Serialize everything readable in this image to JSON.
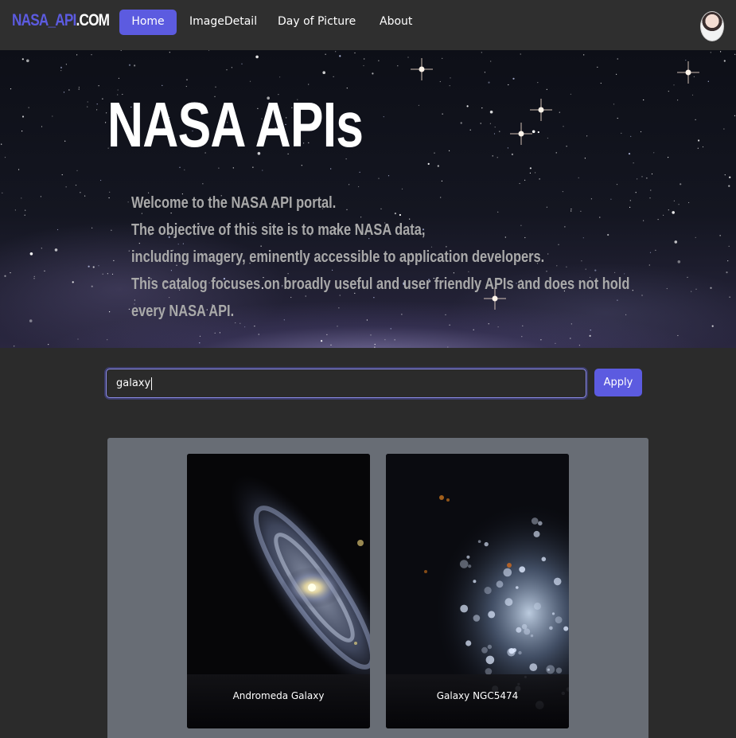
{
  "navbar": {
    "brand_part1": "NASA_API",
    "brand_part2": ".COM",
    "items": [
      {
        "label": "Home",
        "active": true
      },
      {
        "label": "ImageDetail",
        "active": false
      },
      {
        "label": "Day of Picture",
        "active": false
      },
      {
        "label": "About",
        "active": false
      }
    ]
  },
  "hero": {
    "title": "NASA APIs",
    "lines": [
      "Welcome to the NASA API portal.",
      "The objective of this site is to make NASA data,",
      "including imagery, eminently accessible to application developers.",
      "This catalog focuses on broadly useful and user friendly APIs and does not hold",
      "every NASA API."
    ]
  },
  "search": {
    "value": "galaxy",
    "button_label": "Apply"
  },
  "results": {
    "cards": [
      {
        "title": "Andromeda Galaxy"
      },
      {
        "title": "Galaxy NGC5474"
      }
    ]
  },
  "colors": {
    "accent": "#5c5be0",
    "navbar_bg": "#2f2f2f",
    "page_bg": "#2b2b2b",
    "results_bg": "#686d75"
  }
}
